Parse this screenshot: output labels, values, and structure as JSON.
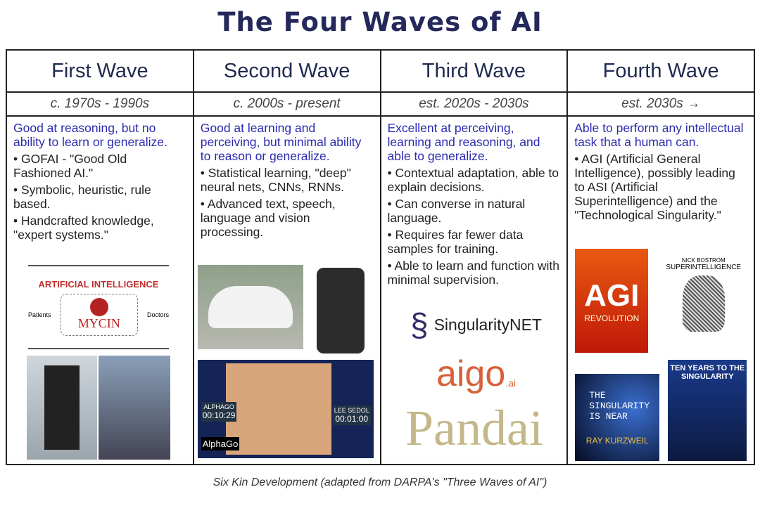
{
  "title": "The Four Waves of AI",
  "waves": [
    {
      "name": "First Wave",
      "period": "c. 1970s - 1990s",
      "summary": "Good at reasoning, but no ability to learn or generalize.",
      "bullets": [
        "• GOFAI - \"Good Old Fashioned AI.\"",
        "• Symbolic, heuristic, rule based.",
        "• Handcrafted knowledge, \"expert systems.\""
      ]
    },
    {
      "name": "Second Wave",
      "period": "c. 2000s - present",
      "summary": "Good at learning and perceiving, but minimal ability to reason or generalize.",
      "bullets": [
        "• Statistical learning, \"deep\" neural nets, CNNs, RNNs.",
        "• Advanced text, speech, language and vision processing."
      ]
    },
    {
      "name": "Third Wave",
      "period": "est. 2020s - 2030s",
      "summary": "Excellent at perceiving, learning and reasoning, and able to generalize.",
      "bullets": [
        "• Contextual adaptation, able to explain decisions.",
        "• Can converse in natural language.",
        "• Requires far fewer data samples for training.",
        "• Able to learn and function with minimal supervision."
      ]
    },
    {
      "name": "Fourth Wave",
      "period": "est. 2030s →",
      "summary": "Able to perform any intellectual task that a human can.",
      "bullets": [
        "• AGI (Artificial General Intelligence), possibly leading to ASI (Artificial Superintelligence) and the \"Technological Singularity.\""
      ]
    }
  ],
  "images": {
    "mycin": {
      "heading": "ARTIFICIAL INTELLIGENCE",
      "label": "MYCIN",
      "patients": "Patients",
      "doctors": "Doctors"
    },
    "alphago": {
      "player1": "ALPHAGO",
      "time1": "00:10:29",
      "player2": "LEE SEDOL",
      "time2": "00:01:00",
      "logo": "AlphaGo"
    },
    "logos": {
      "singularitynet": "SingularityNET",
      "aigo": "aigo",
      "aigo_suffix": ".ai",
      "pandai": "Pandai"
    },
    "books": {
      "agi": "AGI",
      "agi_sub": "REVOLUTION",
      "superintelligence_author": "NICK BOSTROM",
      "superintelligence": "SUPERINTELLIGENCE",
      "singularity": "THE SINGULARITY IS NEAR",
      "kurzweil": "RAY KURZWEIL",
      "tenyears": "TEN YEARS TO THE SINGULARITY"
    }
  },
  "caption": "Six Kin Development (adapted from DARPA's \"Three Waves of AI\")"
}
